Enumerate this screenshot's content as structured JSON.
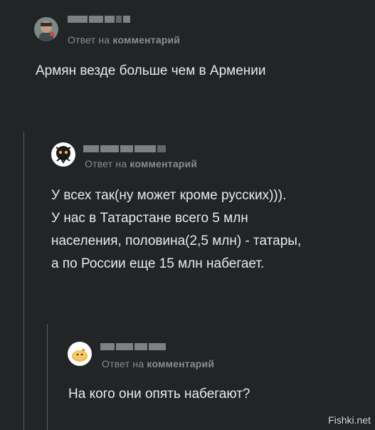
{
  "comments": [
    {
      "reply_prefix": "Ответ на",
      "reply_target": "комментарий",
      "text": "Армян везде больше чем в Армении"
    },
    {
      "reply_prefix": "Ответ на",
      "reply_target": "комментарий",
      "text": "У всех так(ну может кроме русских))).\nУ нас в Татарстане всего 5 млн\nнаселения, половина(2,5 млн) - татары,\nа по России еще 15 млн набегает."
    },
    {
      "reply_prefix": "Ответ на",
      "reply_target": "комментарий",
      "text": "На кого они опять набегают?"
    }
  ],
  "watermark": "Fishki.net",
  "colors": {
    "background": "#222426",
    "thread_line": "#5a5d60",
    "meta_text": "#8a8d90",
    "body_text": "#e9e9e9"
  }
}
